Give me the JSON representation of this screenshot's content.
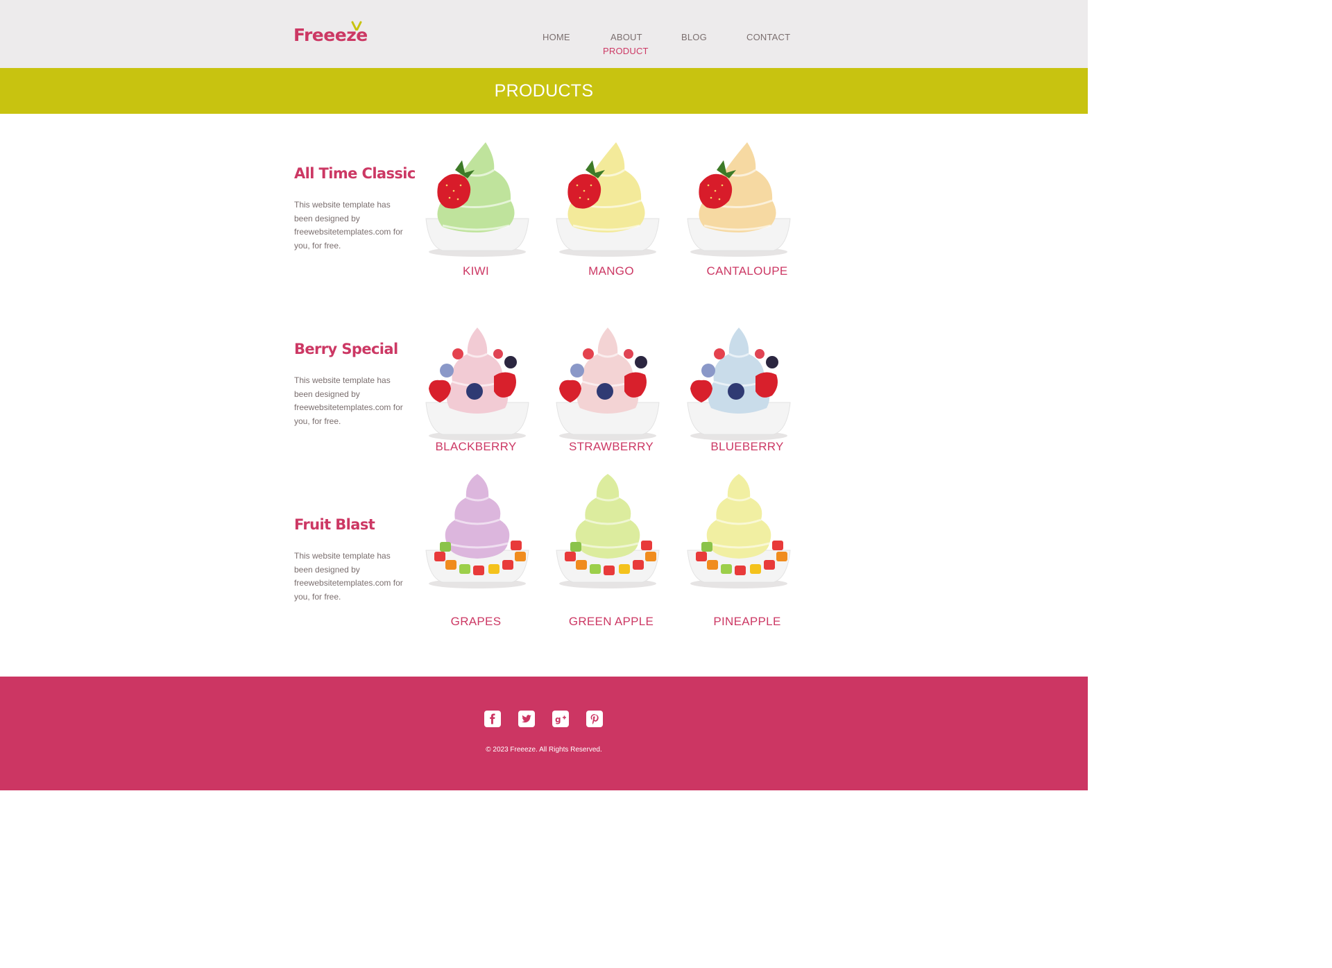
{
  "brand": {
    "name_main": "Freee",
    "name_tail": "ze",
    "primary_color": "#cc3864",
    "accent_color": "#c8c310"
  },
  "nav": {
    "home": "HOME",
    "about": "ABOUT",
    "product": "PRODUCT",
    "blog": "BLOG",
    "contact": "CONTACT",
    "active": "PRODUCT"
  },
  "banner": {
    "title": "PRODUCTS"
  },
  "categories": [
    {
      "title": "All Time Classic",
      "description": "This website template has been designed by freewebsitetemplates.com for you, for free.",
      "products": [
        {
          "name": "KIWI",
          "cream_color": "#bfe39c",
          "topping": "strawberry"
        },
        {
          "name": "MANGO",
          "cream_color": "#f3ea9a",
          "topping": "strawberry"
        },
        {
          "name": "CANTALOUPE",
          "cream_color": "#f6d9a2",
          "topping": "strawberry"
        }
      ]
    },
    {
      "title": "Berry Special",
      "description": "This website template has been designed by freewebsitetemplates.com for you, for free.",
      "products": [
        {
          "name": "BLACKBERRY",
          "cream_color": "#f2cbd4",
          "topping": "berries"
        },
        {
          "name": "STRAWBERRY",
          "cream_color": "#f3d3d4",
          "topping": "berries"
        },
        {
          "name": "BLUEBERRY",
          "cream_color": "#c9dcea",
          "topping": "berries"
        }
      ]
    },
    {
      "title": "Fruit Blast",
      "description": "This website template has been designed by freewebsitetemplates.com for you, for free.",
      "products": [
        {
          "name": "GRAPES",
          "cream_color": "#dcb6dd",
          "topping": "fruit"
        },
        {
          "name": "GREEN APPLE",
          "cream_color": "#dcec9e",
          "topping": "fruit"
        },
        {
          "name": "PINEAPPLE",
          "cream_color": "#f1efa2",
          "topping": "fruit"
        }
      ]
    }
  ],
  "footer": {
    "social": [
      {
        "icon": "facebook-icon"
      },
      {
        "icon": "twitter-icon"
      },
      {
        "icon": "google-plus-icon"
      },
      {
        "icon": "pinterest-icon"
      }
    ],
    "copyright": "© 2023 Freeeze. All Rights Reserved."
  }
}
